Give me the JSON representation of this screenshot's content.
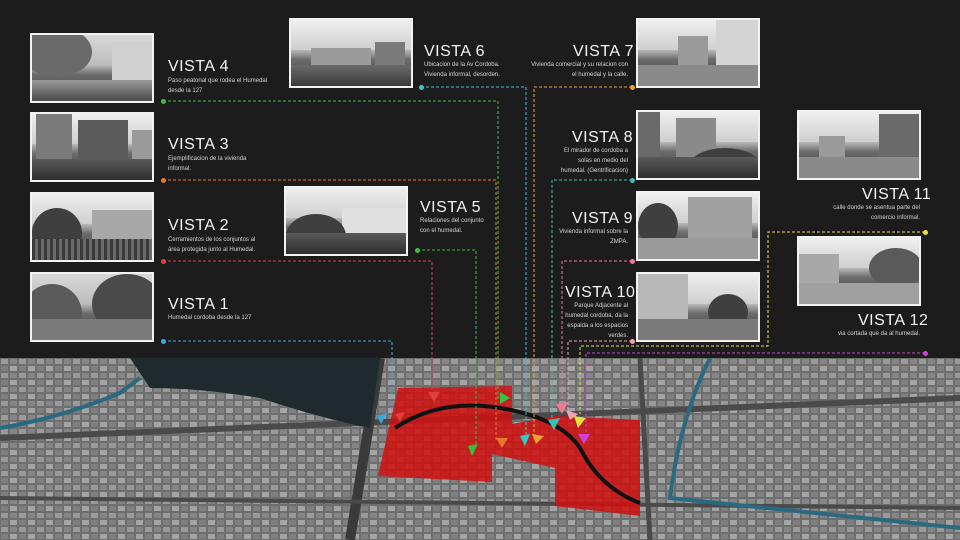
{
  "views": [
    {
      "id": "v1",
      "title": "VISTA 1",
      "description": "Humedal cordoba desde la 127",
      "color": "#3aa8e0"
    },
    {
      "id": "v2",
      "title": "VISTA 2",
      "description": "Cerramientos de los conjuntos al área protegida junto al Humedal.",
      "color": "#e04040"
    },
    {
      "id": "v3",
      "title": "VISTA 3",
      "description": "Ejemplificacion de la vivienda informal.",
      "color": "#e8762c"
    },
    {
      "id": "v4",
      "title": "VISTA 4",
      "description": "Paso peatonal que rodea el Humedal desde la 127",
      "color": "#3cbf4a"
    },
    {
      "id": "v5",
      "title": "VISTA 5",
      "description": "Relaciones del conjunto con el humedal.",
      "color": "#35c23a"
    },
    {
      "id": "v6",
      "title": "VISTA 6",
      "description": "Ubicacion de la Av Cordoba. Vivienda informal, desorden.",
      "color": "#38c8c8"
    },
    {
      "id": "v7",
      "title": "VISTA 7",
      "description": "Vivienda comercial y su relacion con el humedal y la calle.",
      "color": "#f0a030"
    },
    {
      "id": "v8",
      "title": "VISTA 8",
      "description": "El mirador de cordoba a solas en medio del humedal. (Gentrificacion)",
      "color": "#3ac0b0"
    },
    {
      "id": "v9",
      "title": "VISTA 9",
      "description": "Vivienda informal sobre la ZMPA.",
      "color": "#f07898"
    },
    {
      "id": "v10",
      "title": "VISTA 10",
      "description": "Parque Adjacente al humedal cordoba, da la espalda a los espacios verdes.",
      "color": "#f6a0b8"
    },
    {
      "id": "v11",
      "title": "VISTA 11",
      "description": "calle donde se asentua parte del comercio informal.",
      "color": "#e8e040"
    },
    {
      "id": "v12",
      "title": "VISTA 12",
      "description": "via cortada que da al humedal.",
      "color": "#d040d8"
    }
  ]
}
